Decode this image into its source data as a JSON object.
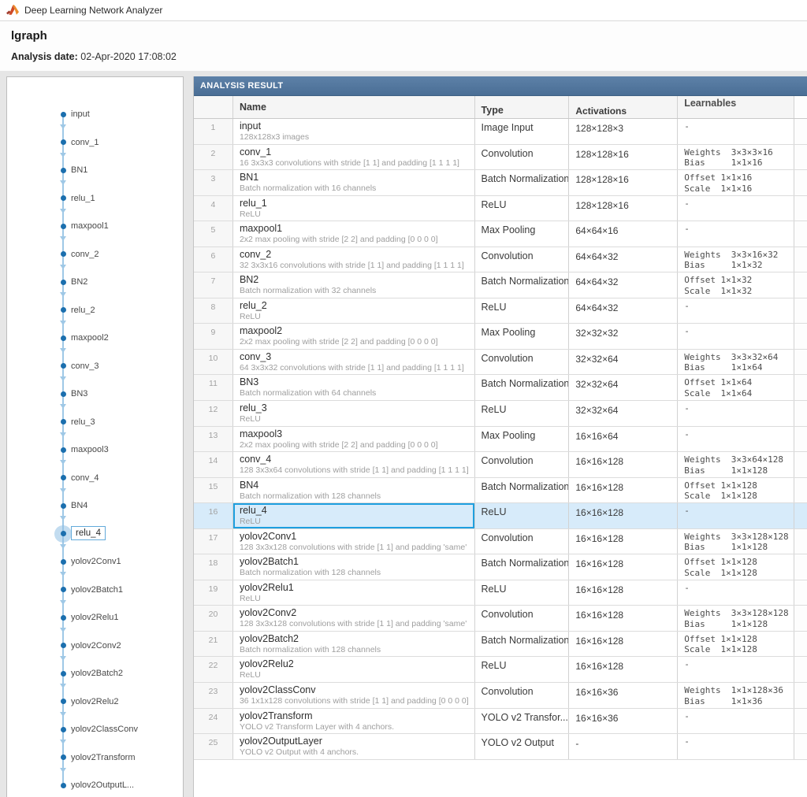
{
  "window": {
    "title": "Deep Learning Network Analyzer",
    "app_icon": "matlab-icon"
  },
  "header": {
    "title": "lgraph",
    "date_label": "Analysis date:",
    "date_value": "02-Apr-2020 17:08:02"
  },
  "colors": {
    "banner_top": "#5d81a8",
    "banner_bottom": "#4a6e95",
    "node_blue": "#1b6fae",
    "edge_blue": "#9fc8e6",
    "halo_blue": "#8fc0e4",
    "sel_fill": "#d7ebfa",
    "sel_border": "#1e9fdf"
  },
  "graph": {
    "selected_node": "relu_4",
    "nodes": [
      "input",
      "conv_1",
      "BN1",
      "relu_1",
      "maxpool1",
      "conv_2",
      "BN2",
      "relu_2",
      "maxpool2",
      "conv_3",
      "BN3",
      "relu_3",
      "maxpool3",
      "conv_4",
      "BN4",
      "relu_4",
      "yolov2Conv1",
      "yolov2Batch1",
      "yolov2Relu1",
      "yolov2Conv2",
      "yolov2Batch2",
      "yolov2Relu2",
      "yolov2ClassConv",
      "yolov2Transform",
      "yolov2OutputL..."
    ]
  },
  "table": {
    "banner": "ANALYSIS RESULT",
    "columns": {
      "name": "Name",
      "type": "Type",
      "activations": "Activations",
      "learnables": "Learnables"
    },
    "rows": [
      {
        "num": 1,
        "name": "input",
        "desc": "128x128x3 images",
        "type": "Image Input",
        "activations": "128×128×3",
        "learnables": "-"
      },
      {
        "num": 2,
        "name": "conv_1",
        "desc": "16 3x3x3 convolutions with stride [1 1] and padding [1 1 1 1]",
        "type": "Convolution",
        "activations": "128×128×16",
        "learnables": "Weights  3×3×3×16\nBias     1×1×16"
      },
      {
        "num": 3,
        "name": "BN1",
        "desc": "Batch normalization with 16 channels",
        "type": "Batch Normalization",
        "activations": "128×128×16",
        "learnables": "Offset 1×1×16\nScale  1×1×16"
      },
      {
        "num": 4,
        "name": "relu_1",
        "desc": "ReLU",
        "type": "ReLU",
        "activations": "128×128×16",
        "learnables": "-"
      },
      {
        "num": 5,
        "name": "maxpool1",
        "desc": "2x2 max pooling with stride [2 2] and padding [0 0 0 0]",
        "type": "Max Pooling",
        "activations": "64×64×16",
        "learnables": "-"
      },
      {
        "num": 6,
        "name": "conv_2",
        "desc": "32 3x3x16 convolutions with stride [1 1] and padding [1 1 1 1]",
        "type": "Convolution",
        "activations": "64×64×32",
        "learnables": "Weights  3×3×16×32\nBias     1×1×32"
      },
      {
        "num": 7,
        "name": "BN2",
        "desc": "Batch normalization with 32 channels",
        "type": "Batch Normalization",
        "activations": "64×64×32",
        "learnables": "Offset 1×1×32\nScale  1×1×32"
      },
      {
        "num": 8,
        "name": "relu_2",
        "desc": "ReLU",
        "type": "ReLU",
        "activations": "64×64×32",
        "learnables": "-"
      },
      {
        "num": 9,
        "name": "maxpool2",
        "desc": "2x2 max pooling with stride [2 2] and padding [0 0 0 0]",
        "type": "Max Pooling",
        "activations": "32×32×32",
        "learnables": "-"
      },
      {
        "num": 10,
        "name": "conv_3",
        "desc": "64 3x3x32 convolutions with stride [1 1] and padding [1 1 1 1]",
        "type": "Convolution",
        "activations": "32×32×64",
        "learnables": "Weights  3×3×32×64\nBias     1×1×64"
      },
      {
        "num": 11,
        "name": "BN3",
        "desc": "Batch normalization with 64 channels",
        "type": "Batch Normalization",
        "activations": "32×32×64",
        "learnables": "Offset 1×1×64\nScale  1×1×64"
      },
      {
        "num": 12,
        "name": "relu_3",
        "desc": "ReLU",
        "type": "ReLU",
        "activations": "32×32×64",
        "learnables": "-"
      },
      {
        "num": 13,
        "name": "maxpool3",
        "desc": "2x2 max pooling with stride [2 2] and padding [0 0 0 0]",
        "type": "Max Pooling",
        "activations": "16×16×64",
        "learnables": "-"
      },
      {
        "num": 14,
        "name": "conv_4",
        "desc": "128 3x3x64 convolutions with stride [1 1] and padding [1 1 1 1]",
        "type": "Convolution",
        "activations": "16×16×128",
        "learnables": "Weights  3×3×64×128\nBias     1×1×128"
      },
      {
        "num": 15,
        "name": "BN4",
        "desc": "Batch normalization with 128 channels",
        "type": "Batch Normalization",
        "activations": "16×16×128",
        "learnables": "Offset 1×1×128\nScale  1×1×128"
      },
      {
        "num": 16,
        "name": "relu_4",
        "desc": "ReLU",
        "type": "ReLU",
        "activations": "16×16×128",
        "learnables": "-",
        "selected": true
      },
      {
        "num": 17,
        "name": "yolov2Conv1",
        "desc": "128 3x3x128 convolutions with stride [1 1] and padding 'same'",
        "type": "Convolution",
        "activations": "16×16×128",
        "learnables": "Weights  3×3×128×128\nBias     1×1×128"
      },
      {
        "num": 18,
        "name": "yolov2Batch1",
        "desc": "Batch normalization with 128 channels",
        "type": "Batch Normalization",
        "activations": "16×16×128",
        "learnables": "Offset 1×1×128\nScale  1×1×128"
      },
      {
        "num": 19,
        "name": "yolov2Relu1",
        "desc": "ReLU",
        "type": "ReLU",
        "activations": "16×16×128",
        "learnables": "-"
      },
      {
        "num": 20,
        "name": "yolov2Conv2",
        "desc": "128 3x3x128 convolutions with stride [1 1] and padding 'same'",
        "type": "Convolution",
        "activations": "16×16×128",
        "learnables": "Weights  3×3×128×128\nBias     1×1×128"
      },
      {
        "num": 21,
        "name": "yolov2Batch2",
        "desc": "Batch normalization with 128 channels",
        "type": "Batch Normalization",
        "activations": "16×16×128",
        "learnables": "Offset 1×1×128\nScale  1×1×128"
      },
      {
        "num": 22,
        "name": "yolov2Relu2",
        "desc": "ReLU",
        "type": "ReLU",
        "activations": "16×16×128",
        "learnables": "-"
      },
      {
        "num": 23,
        "name": "yolov2ClassConv",
        "desc": "36 1x1x128 convolutions with stride [1 1] and padding [0 0 0 0]",
        "type": "Convolution",
        "activations": "16×16×36",
        "learnables": "Weights  1×1×128×36\nBias     1×1×36"
      },
      {
        "num": 24,
        "name": "yolov2Transform",
        "desc": "YOLO v2 Transform Layer with 4 anchors.",
        "type": "YOLO v2 Transfor...",
        "activations": "16×16×36",
        "learnables": "-"
      },
      {
        "num": 25,
        "name": "yolov2OutputLayer",
        "desc": "YOLO v2 Output with 4 anchors.",
        "type": "YOLO v2 Output",
        "activations": "-",
        "learnables": "-"
      }
    ]
  }
}
